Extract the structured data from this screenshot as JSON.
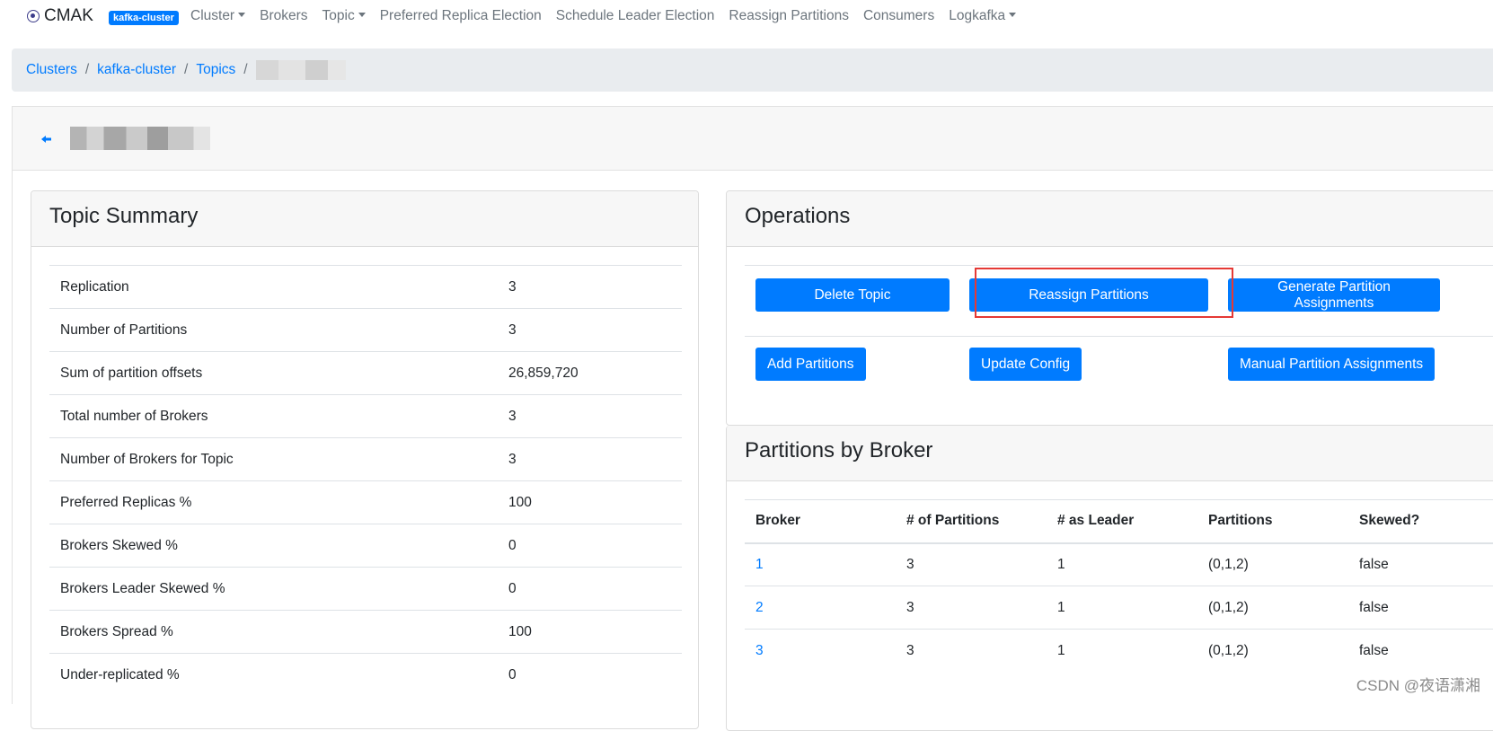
{
  "navbar": {
    "brand": "CMAK",
    "cluster_badge": "kafka-cluster",
    "items": [
      {
        "label": "Cluster",
        "dropdown": true
      },
      {
        "label": "Brokers",
        "dropdown": false
      },
      {
        "label": "Topic",
        "dropdown": true
      },
      {
        "label": "Preferred Replica Election",
        "dropdown": false
      },
      {
        "label": "Schedule Leader Election",
        "dropdown": false
      },
      {
        "label": "Reassign Partitions",
        "dropdown": false
      },
      {
        "label": "Consumers",
        "dropdown": false
      },
      {
        "label": "Logkafka",
        "dropdown": true
      }
    ]
  },
  "breadcrumb": {
    "items": [
      "Clusters",
      "kafka-cluster",
      "Topics"
    ],
    "separator": "/"
  },
  "topic_header": {
    "back_icon": "arrow-left-icon"
  },
  "summary": {
    "title": "Topic Summary",
    "rows": [
      {
        "label": "Replication",
        "value": "3"
      },
      {
        "label": "Number of Partitions",
        "value": "3"
      },
      {
        "label": "Sum of partition offsets",
        "value": "26,859,720"
      },
      {
        "label": "Total number of Brokers",
        "value": "3"
      },
      {
        "label": "Number of Brokers for Topic",
        "value": "3"
      },
      {
        "label": "Preferred Replicas %",
        "value": "100"
      },
      {
        "label": "Brokers Skewed %",
        "value": "0"
      },
      {
        "label": "Brokers Leader Skewed %",
        "value": "0"
      },
      {
        "label": "Brokers Spread %",
        "value": "100"
      },
      {
        "label": "Under-replicated %",
        "value": "0"
      }
    ]
  },
  "operations": {
    "title": "Operations",
    "buttons": {
      "delete_topic": "Delete Topic",
      "reassign_partitions": "Reassign Partitions",
      "generate_assignments": "Generate Partition Assignments",
      "add_partitions": "Add Partitions",
      "update_config": "Update Config",
      "manual_assignments": "Manual Partition Assignments"
    }
  },
  "partitions_by_broker": {
    "title": "Partitions by Broker",
    "columns": [
      "Broker",
      "# of Partitions",
      "# as Leader",
      "Partitions",
      "Skewed?"
    ],
    "rows": [
      {
        "broker": "1",
        "partitions_count": "3",
        "as_leader": "1",
        "partitions": "(0,1,2)",
        "skewed": "false"
      },
      {
        "broker": "2",
        "partitions_count": "3",
        "as_leader": "1",
        "partitions": "(0,1,2)",
        "skewed": "false"
      },
      {
        "broker": "3",
        "partitions_count": "3",
        "as_leader": "1",
        "partitions": "(0,1,2)",
        "skewed": "false"
      }
    ]
  },
  "watermark": "CSDN @夜语潇湘",
  "colors": {
    "primary": "#007bff",
    "highlight": "#e53935",
    "breadcrumb_bg": "#e9ecef"
  }
}
